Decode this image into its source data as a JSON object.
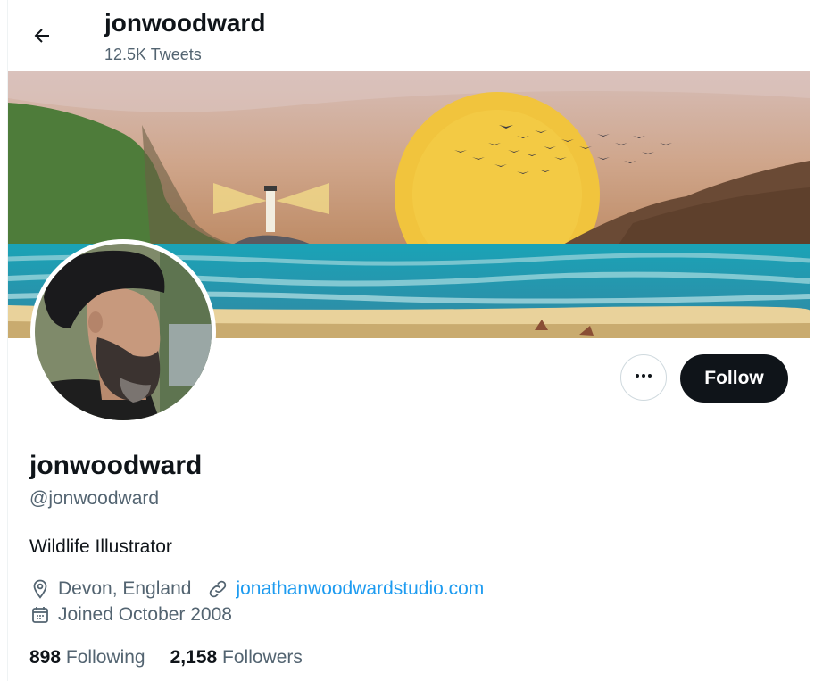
{
  "header": {
    "title": "jonwoodward",
    "tweet_count": "12.5K Tweets",
    "back_icon": "arrow-left-icon"
  },
  "banner": {
    "colors": {
      "sky_top": "#cfb3aa",
      "sky_mid": "#c9956b",
      "sun": "#f2c43a",
      "sea": "#1f9bb0",
      "sand": "#e8cf96",
      "hill": "#4f7d3a"
    }
  },
  "profile": {
    "display_name": "jonwoodward",
    "handle": "@jonwoodward",
    "bio": "Wildlife Illustrator",
    "location": "Devon, England",
    "website": "jonathanwoodwardstudio.com",
    "joined": "Joined October 2008",
    "following_count": "898",
    "following_label": "Following",
    "followers_count": "2,158",
    "followers_label": "Followers"
  },
  "actions": {
    "follow_label": "Follow",
    "more_icon": "more-horizontal-icon"
  },
  "colors": {
    "accent": "#1d9bf0",
    "text_primary": "#0f1419",
    "text_secondary": "#536471",
    "button_dark": "#0f1419"
  }
}
